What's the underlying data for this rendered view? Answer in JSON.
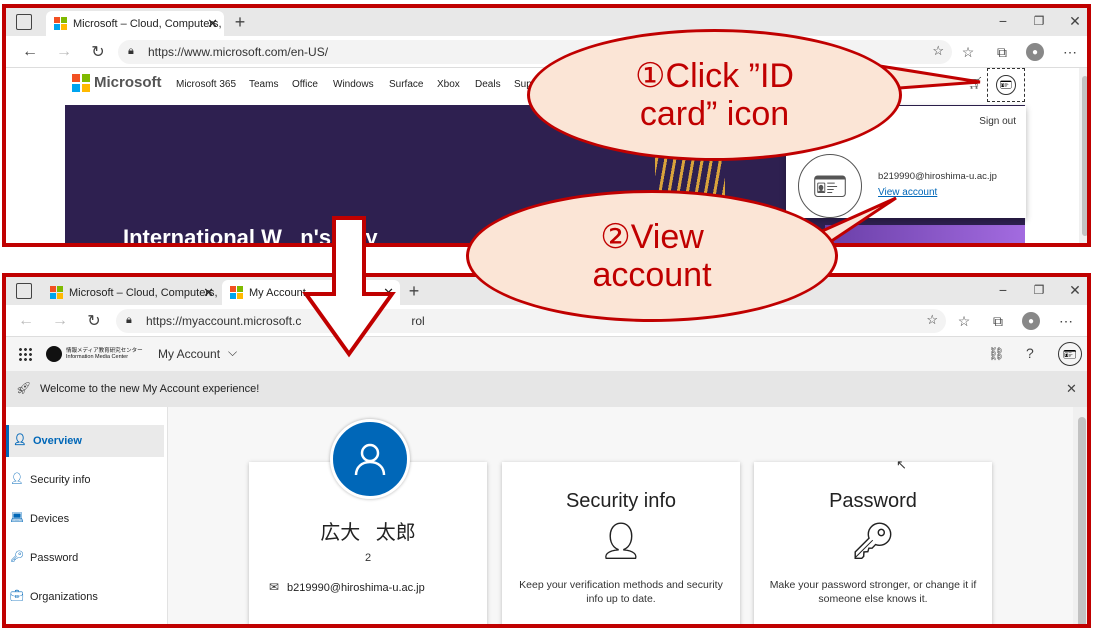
{
  "top_browser": {
    "tab_title": "Microsoft – Cloud, Computers, A",
    "url": "https://www.microsoft.com/en-US/",
    "brand": "Microsoft",
    "nav": [
      "Microsoft 365",
      "Teams",
      "Office",
      "Windows",
      "Surface",
      "Xbox",
      "Deals",
      "Sup"
    ],
    "hero_text": "International W   n's Day",
    "account_popup": {
      "sign_out": "Sign out",
      "email": "b219990@hiroshima-u.ac.jp",
      "view_account": "View account"
    }
  },
  "bottom_browser": {
    "tab1_title": "Microsoft – Cloud, Computers, A",
    "tab2_title": "My Account",
    "url_start": "https://myaccount.microsoft.c",
    "url_end": "rol",
    "app_title": "My Account",
    "org_logo_line1": "情報メディア教育研究センター",
    "org_logo_line2": "Information Media Center",
    "banner": "Welcome to the new My Account experience!",
    "sidebar": [
      "Overview",
      "Security info",
      "Devices",
      "Password",
      "Organizations"
    ],
    "profile": {
      "name": "広大 太郎",
      "number": "2",
      "email": "b219990@hiroshima-u.ac.jp"
    },
    "security_card": {
      "title": "Security info",
      "desc": "Keep your verification methods and security info up to date."
    },
    "password_card": {
      "title": "Password",
      "desc": "Make your password stronger, or change it if someone else knows it."
    }
  },
  "annotations": {
    "step1": "①Click ”ID card” icon",
    "step2": "②View account"
  },
  "colors": {
    "frame": "#c00000",
    "callout_fill": "#fbe5d6",
    "accent": "#0067b8",
    "hero": "#2e2050"
  }
}
